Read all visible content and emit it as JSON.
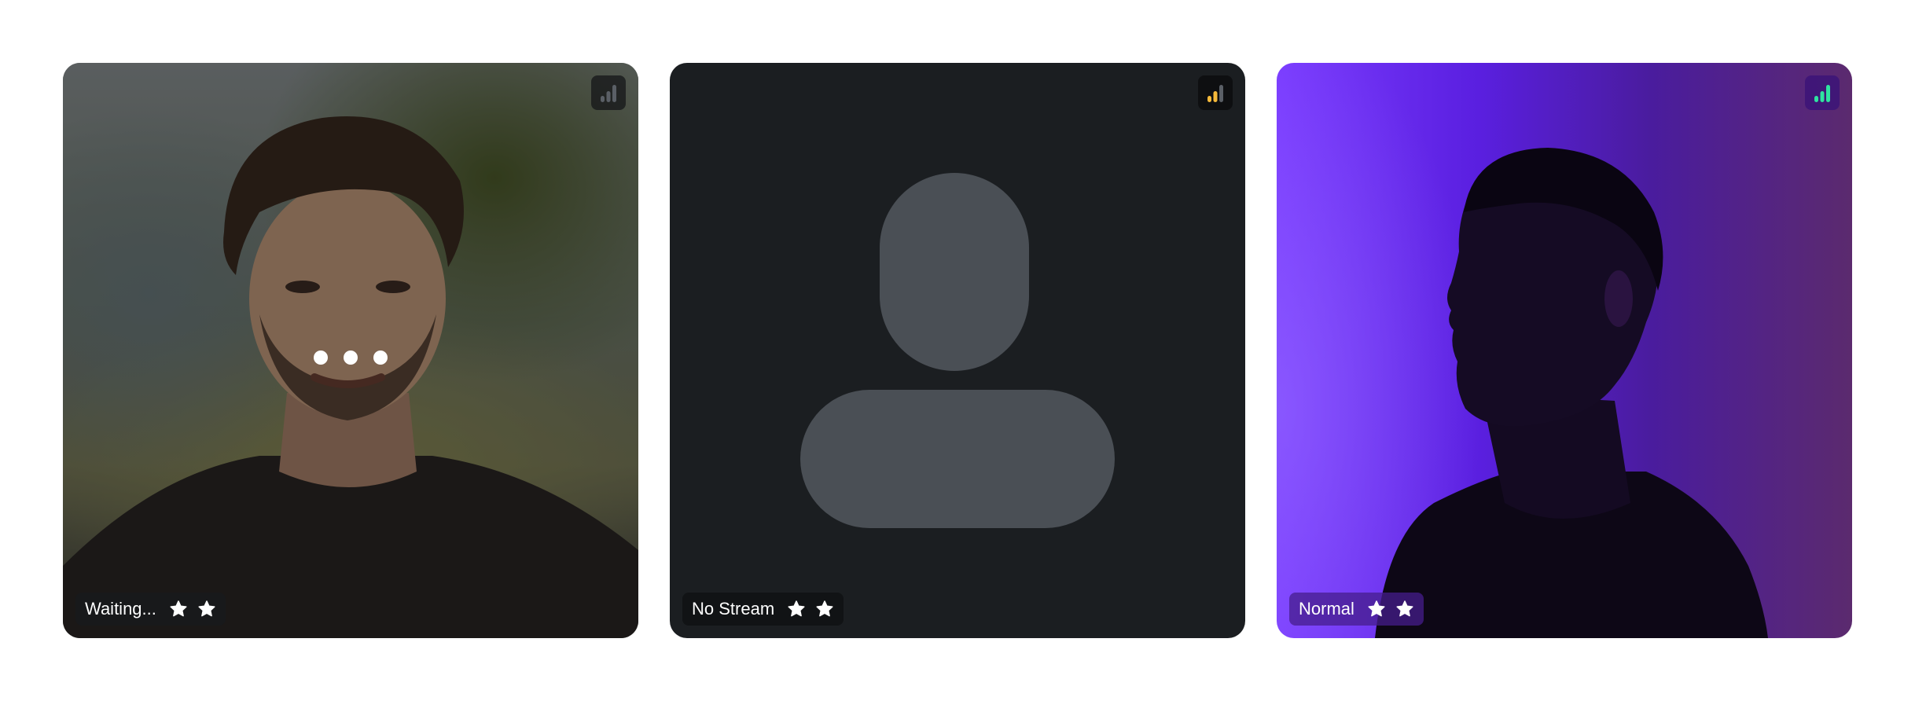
{
  "tiles": [
    {
      "state": "waiting",
      "label": "Waiting...",
      "signal": {
        "level": 0,
        "active_color": "#8a8f94"
      },
      "badges": [
        "star-icon",
        "star-icon"
      ],
      "loading_indicator": "three-dots"
    },
    {
      "state": "no-stream",
      "label": "No Stream",
      "signal": {
        "level": 2,
        "active_color": "#f5b93a"
      },
      "badges": [
        "star-icon",
        "star-icon"
      ]
    },
    {
      "state": "normal",
      "label": "Normal",
      "signal": {
        "level": 3,
        "active_color": "#2fe3a0"
      },
      "badges": [
        "star-icon",
        "star-icon"
      ]
    }
  ],
  "colors": {
    "page_background": "#ffffff",
    "tile_dark": "#1b1e21",
    "placeholder_shape": "#4a4f55",
    "signal_inactive": "#5a5f66",
    "purple_accent": "#7a3bff"
  }
}
